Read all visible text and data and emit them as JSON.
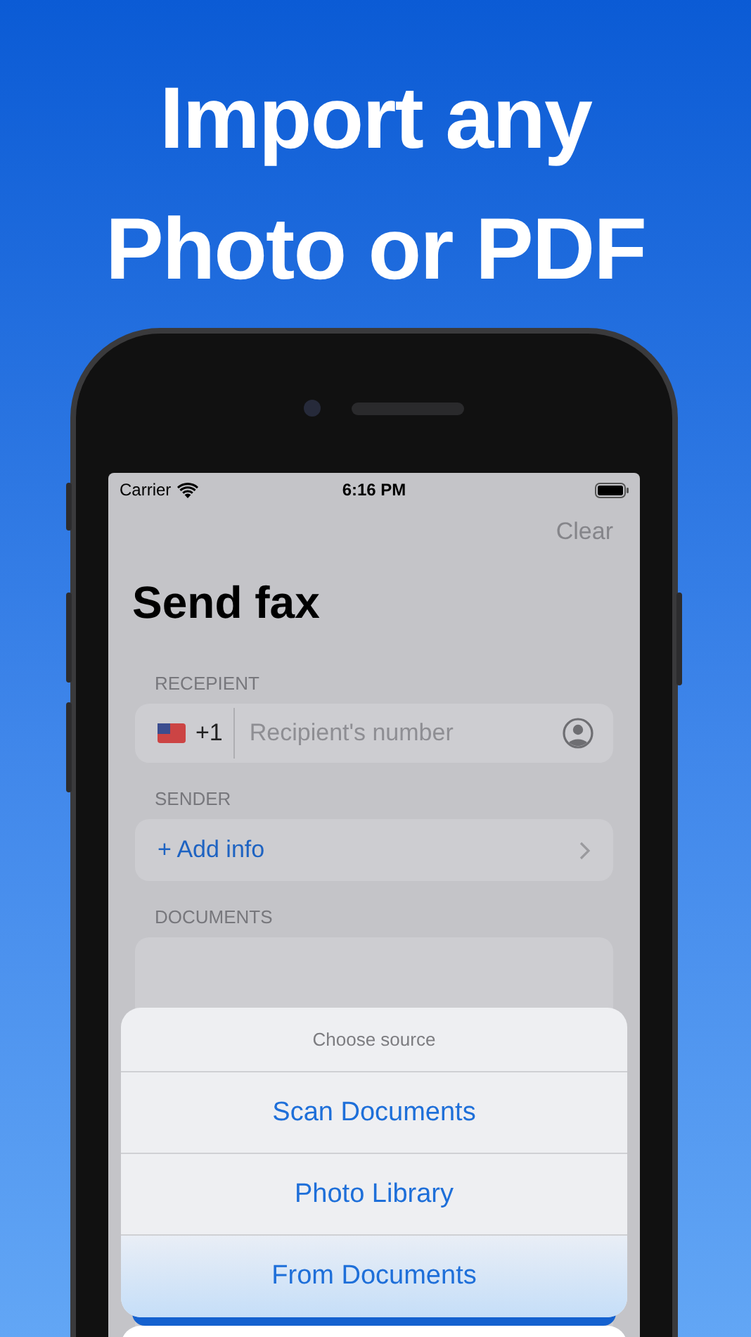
{
  "headline": [
    "Import any",
    "Photo or PDF"
  ],
  "status_bar": {
    "carrier": "Carrier",
    "time": "6:16 PM"
  },
  "nav": {
    "action": "Clear"
  },
  "title": "Send fax",
  "recipient": {
    "label": "RECEPIENT",
    "country_code": "+1",
    "placeholder": "Recipient's number"
  },
  "sender": {
    "label": "SENDER",
    "action": "+ Add info"
  },
  "documents": {
    "label": "DOCUMENTS"
  },
  "sheet": {
    "title": "Choose source",
    "actions": [
      {
        "label": "Scan Documents",
        "selected": false
      },
      {
        "label": "Photo Library",
        "selected": false
      },
      {
        "label": "From Documents",
        "selected": true
      }
    ]
  }
}
